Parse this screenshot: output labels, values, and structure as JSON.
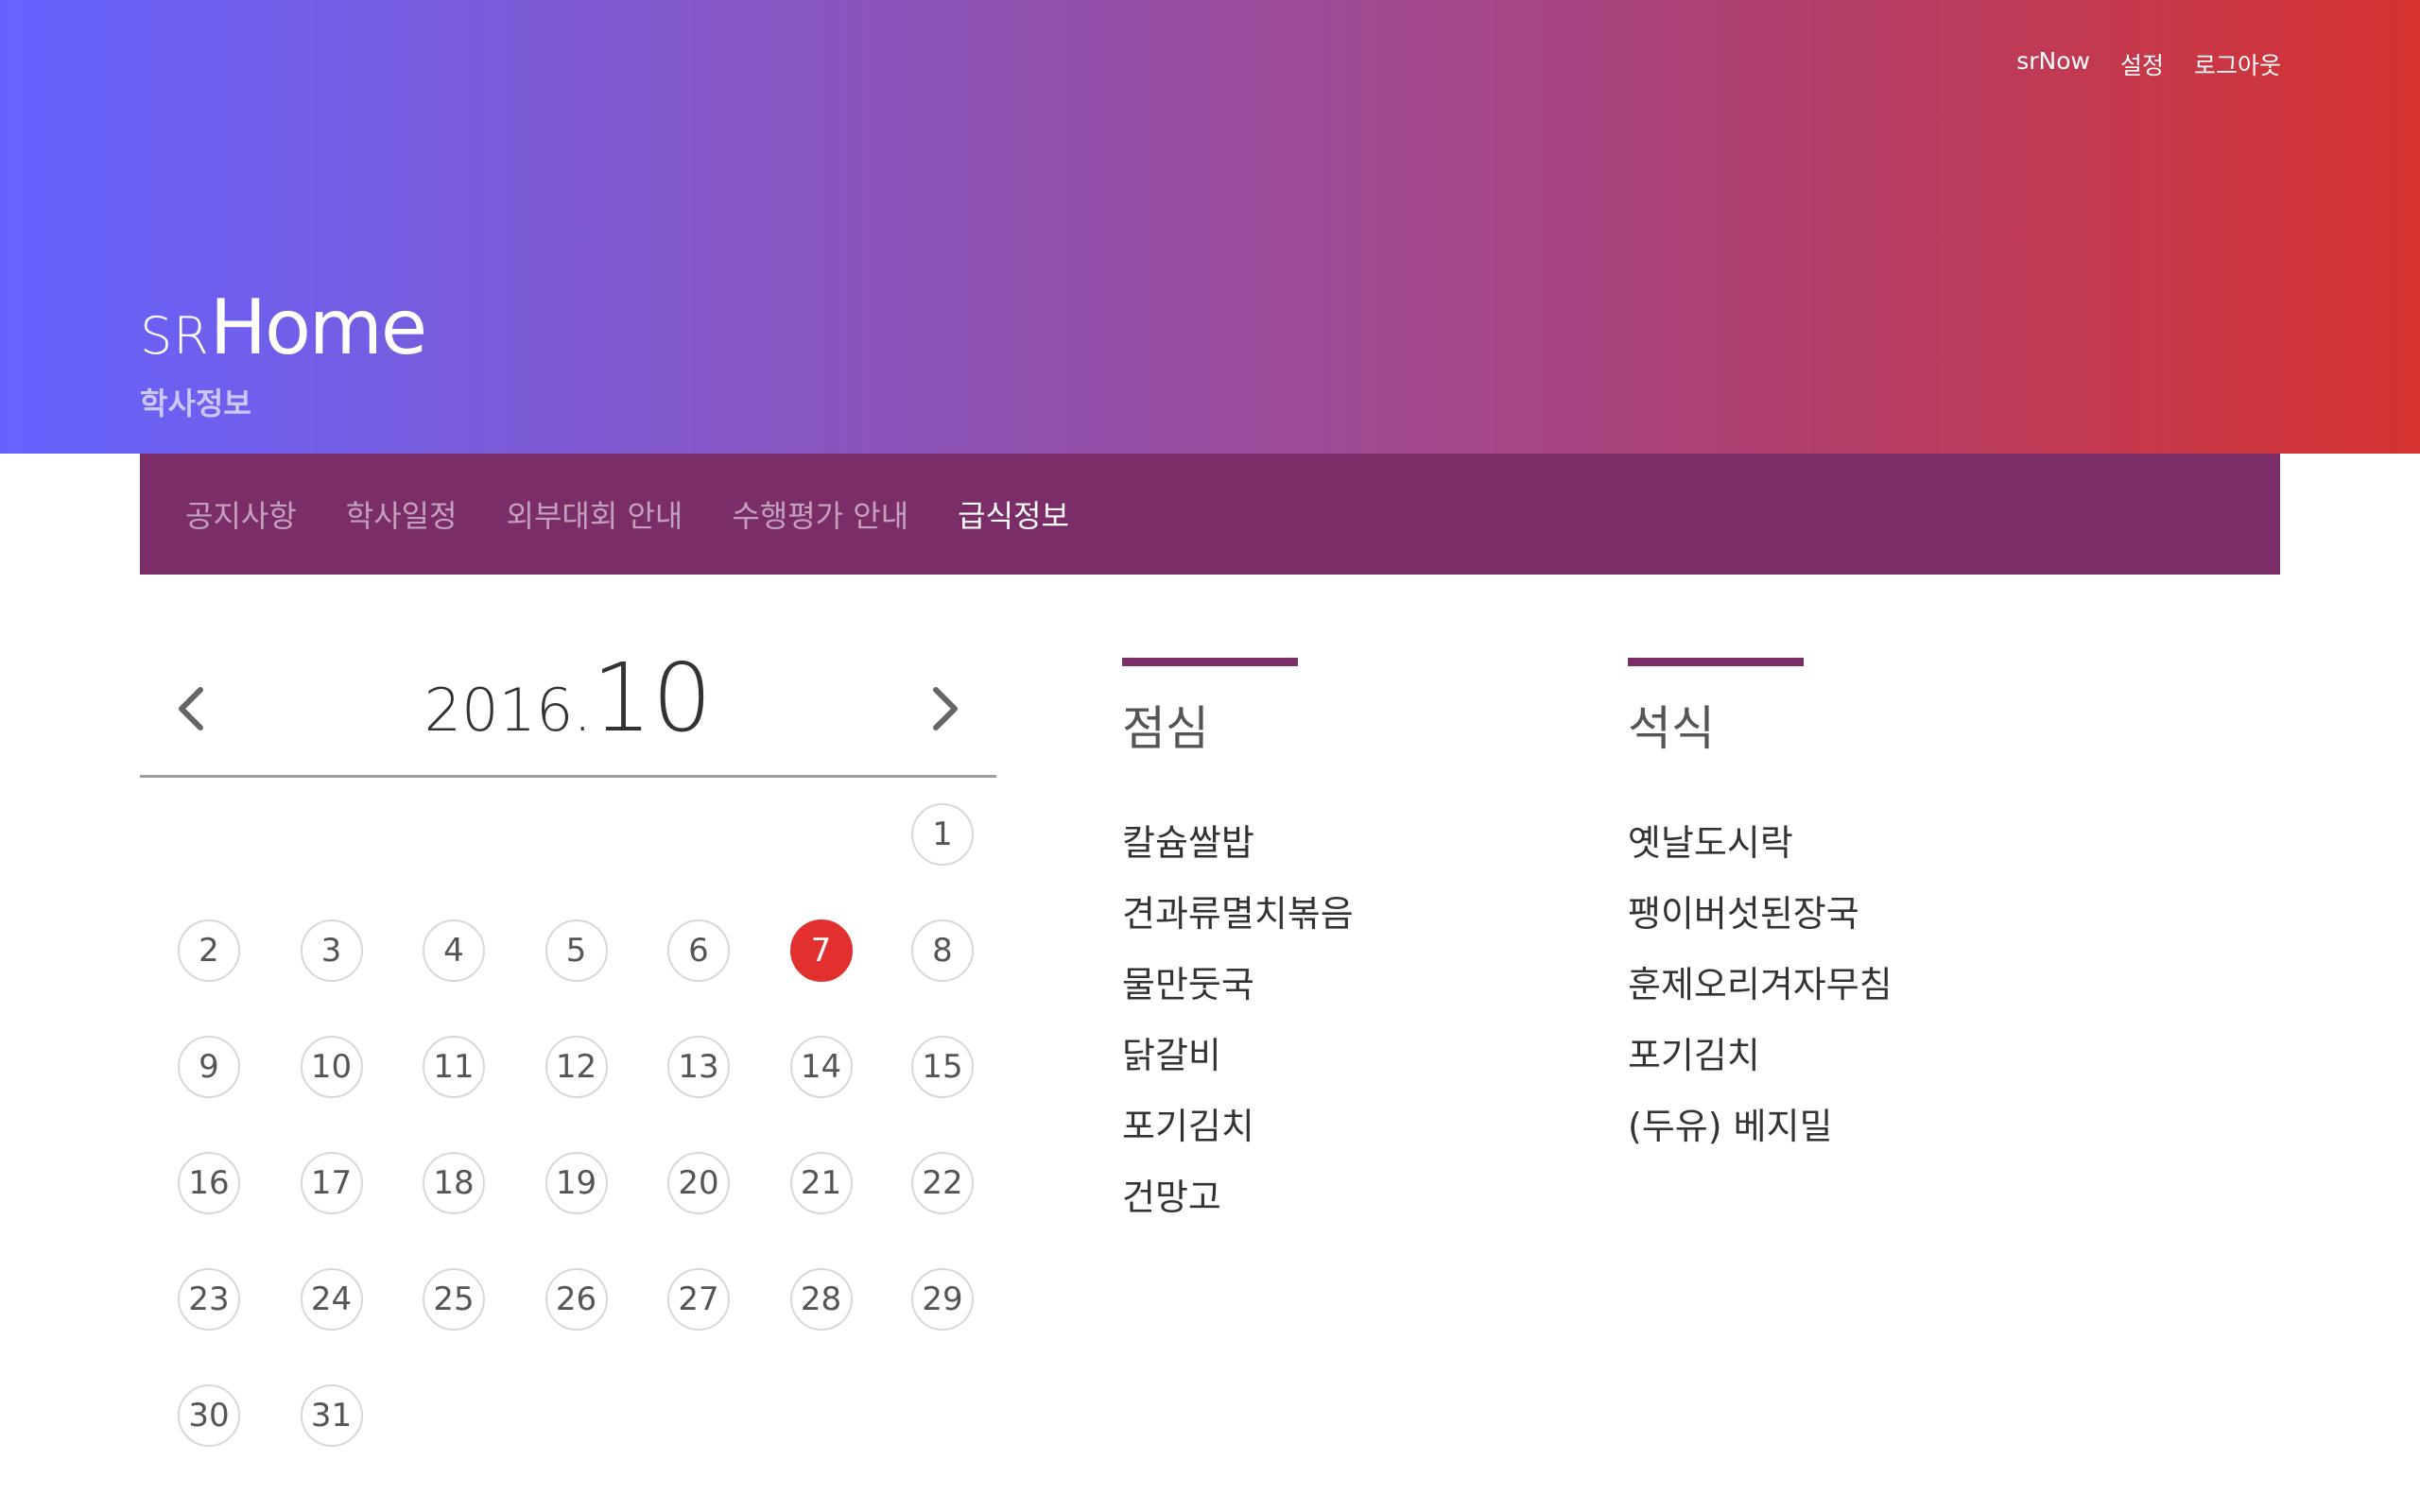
{
  "header": {
    "links": [
      "srNow",
      "설정",
      "로그아웃"
    ],
    "logo_small": "SR",
    "logo_large": "Home",
    "subtitle": "학사정보"
  },
  "tabs": [
    {
      "label": "공지사항",
      "active": false
    },
    {
      "label": "학사일정",
      "active": false
    },
    {
      "label": "외부대회 안내",
      "active": false
    },
    {
      "label": "수행평가 안내",
      "active": false
    },
    {
      "label": "급식정보",
      "active": true
    }
  ],
  "calendar": {
    "year": "2016.",
    "month": "10",
    "first_weekday": 6,
    "days_in_month": 31,
    "selected_day": 7,
    "prev_icon": "chevron-left-icon",
    "next_icon": "chevron-right-icon"
  },
  "meals": {
    "lunch": {
      "title": "점심",
      "items": [
        "칼슘쌀밥",
        "견과류멸치볶음",
        "물만둣국",
        "닭갈비",
        "포기김치",
        "건망고"
      ]
    },
    "dinner": {
      "title": "석식",
      "items": [
        "옛날도시락",
        "팽이버섯된장국",
        "훈제오리겨자무침",
        "포기김치",
        "(두유) 베지밀"
      ]
    }
  },
  "colors": {
    "accent": "#7b2d68",
    "selected": "#e2302e",
    "gradient_start": "#6563ff",
    "gradient_end": "#d6322f"
  }
}
